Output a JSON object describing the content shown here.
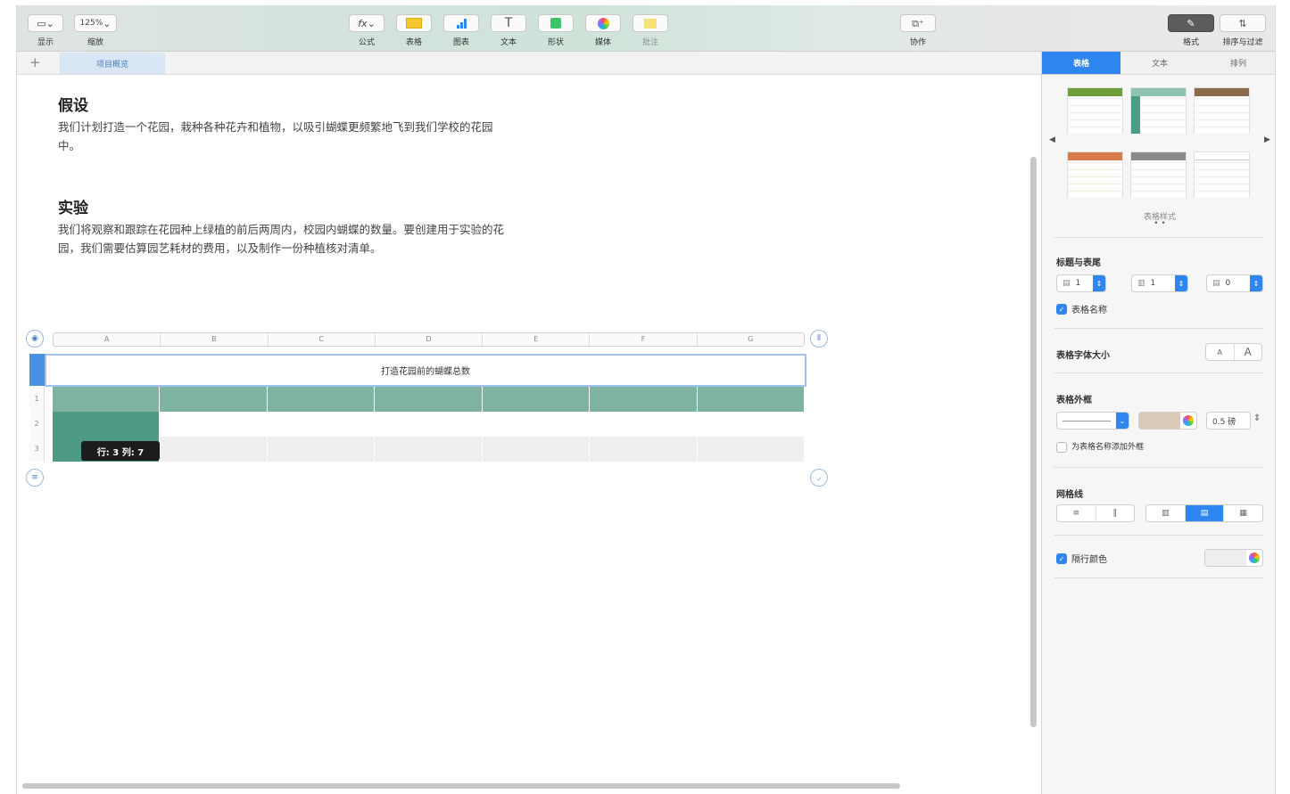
{
  "toolbar": {
    "view": {
      "label": "显示"
    },
    "zoom": {
      "value": "125%",
      "label": "缩放"
    },
    "formula": {
      "icon": "fx",
      "label": "公式"
    },
    "table": {
      "label": "表格"
    },
    "chart": {
      "label": "图表"
    },
    "text": {
      "icon": "T",
      "label": "文本"
    },
    "shape": {
      "label": "形状"
    },
    "media": {
      "label": "媒体"
    },
    "comment": {
      "label": "批注"
    },
    "collaborate": {
      "label": "协作"
    },
    "format": {
      "label": "格式"
    },
    "sort_filter": {
      "label": "排序与过滤"
    }
  },
  "tabs": {
    "add": "+",
    "active": "项目概览"
  },
  "document": {
    "heading1": "假设",
    "para1": "我们计划打造一个花园，栽种各种花卉和植物，以吸引蝴蝶更频繁地飞到我们学校的花园中。",
    "heading2": "实验",
    "para2": "我们将观察和跟踪在花园种上绿植的前后两周内，校园内蝴蝶的数量。要创建用于实验的花园，我们需要估算园艺耗材的费用，以及制作一份种植核对清单。"
  },
  "table": {
    "columns": [
      "A",
      "B",
      "C",
      "D",
      "E",
      "F",
      "G"
    ],
    "title": "打造花园前的蝴蝶总数",
    "rows": [
      "1",
      "2",
      "3"
    ],
    "tooltip": "行: 3 列: 7",
    "header_color": "#7fb3a1",
    "selected_color": "#4e9a84",
    "alt_row_color": "#eeeeee"
  },
  "sidebar": {
    "tabs": [
      "表格",
      "文本",
      "排列"
    ],
    "styles_label": "表格样式",
    "style_colors": [
      "#6e9e3a",
      "#5aa08b",
      "#8a6a4a",
      "#d97b4a",
      "#8a8a8a",
      "#ffffff"
    ],
    "headers_footers": {
      "label": "标题与表尾",
      "header_rows": "1",
      "header_cols": "1",
      "footer_rows": "0"
    },
    "table_name": {
      "label": "表格名称",
      "checked": true
    },
    "font_size": {
      "label": "表格字体大小",
      "smaller": "A",
      "larger": "A"
    },
    "outline": {
      "label": "表格外框",
      "width": "0.5 磅",
      "swatch_color": "#d9c9b6"
    },
    "outline_name": {
      "label": "为表格名称添加外框",
      "checked": false
    },
    "gridlines": {
      "label": "网格线"
    },
    "alt_row": {
      "label": "隔行颜色",
      "checked": true,
      "swatch_color": "#eeeeee"
    }
  }
}
